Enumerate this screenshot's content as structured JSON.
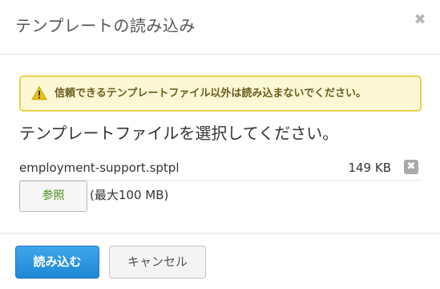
{
  "dialog": {
    "title": "テンプレートの読み込み",
    "close_icon": "close-icon",
    "close_glyph": "✖"
  },
  "warning": {
    "icon": "warning-icon",
    "text": "信頼できるテンプレートファイル以外は読み込まないでください。",
    "colors": {
      "background": "#fcf8d5",
      "border": "#e6d34a",
      "icon": "#e6c21a"
    }
  },
  "prompt": "テンプレートファイルを選択してください。",
  "file": {
    "name": "employment-support.sptpl",
    "size": "149 KB",
    "remove_icon": "remove-file-icon",
    "remove_glyph": "✖"
  },
  "browse": {
    "label": "参照",
    "max_size": "(最大100 MB)"
  },
  "footer": {
    "load_label": "読み込む",
    "cancel_label": "キャンセル",
    "colors": {
      "primary": "#2a95dd"
    }
  }
}
